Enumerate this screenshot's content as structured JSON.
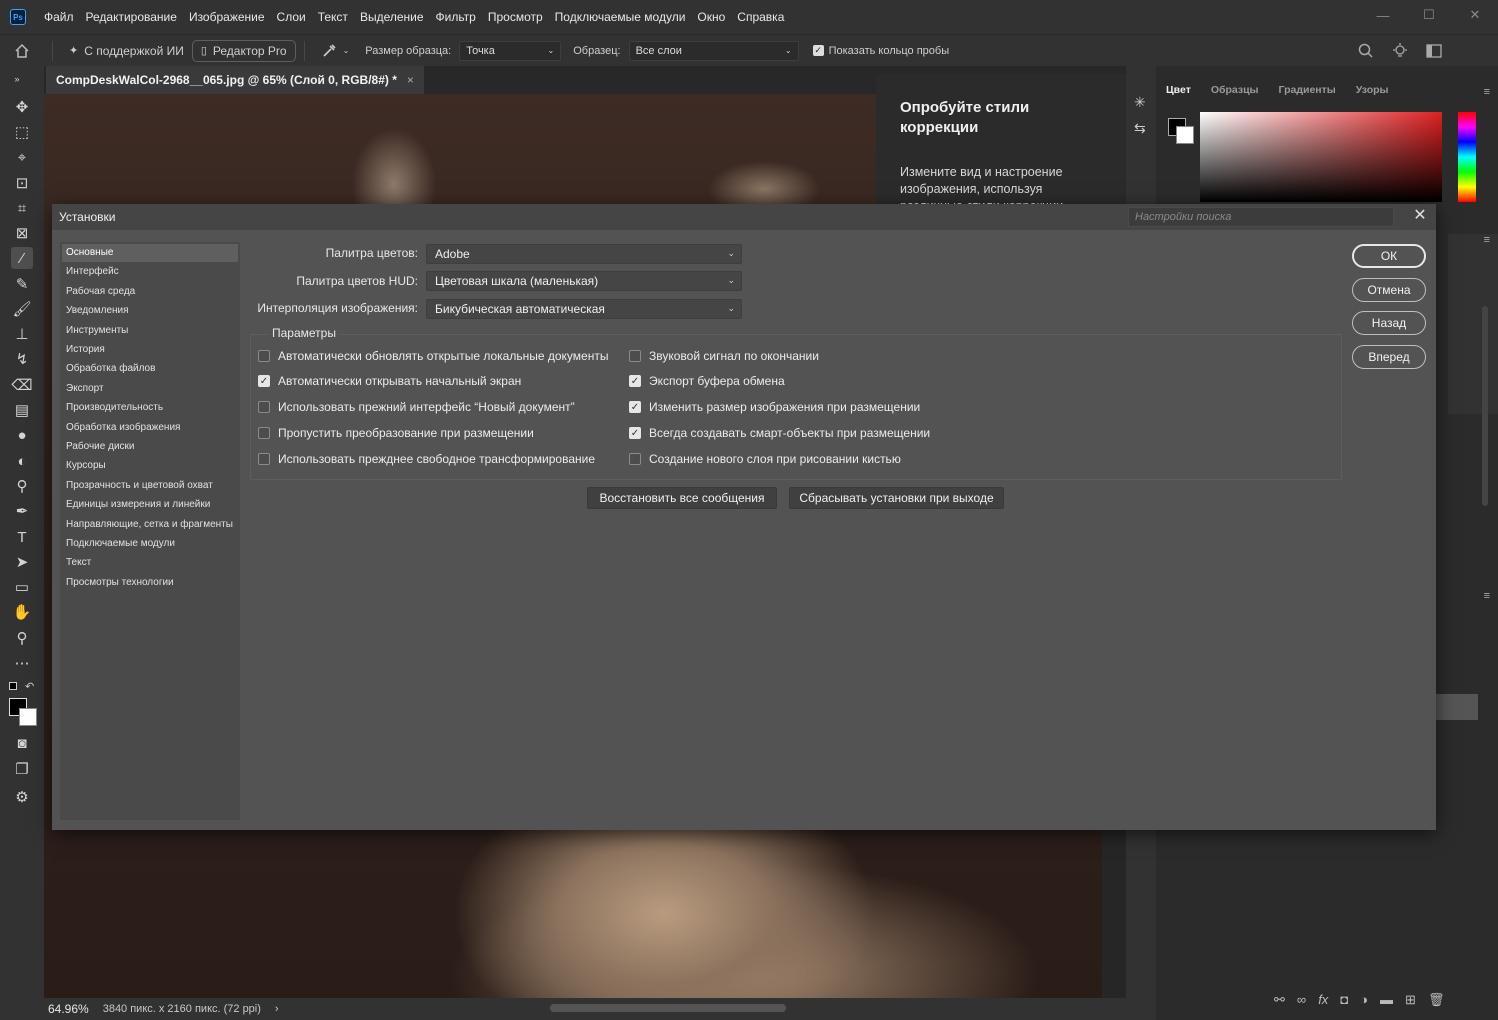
{
  "menubar": {
    "logo": "Ps",
    "items": [
      "Файл",
      "Редактирование",
      "Изображение",
      "Слои",
      "Текст",
      "Выделение",
      "Фильтр",
      "Просмотр",
      "Подключаемые модули",
      "Окно",
      "Справка"
    ],
    "window_controls": [
      "—",
      "☐",
      "✕"
    ]
  },
  "options": {
    "ai_label": "С поддержкой ИИ",
    "pro_label": "Редактор Pro",
    "sample_size_label": "Размер образца:",
    "sample_size_value": "Точка",
    "sample_label": "Образец:",
    "sample_value": "Все слои",
    "show_ring_label": "Показать кольцо пробы",
    "show_ring_checked": true
  },
  "document": {
    "tab_title": "CompDeskWalCol-2968__065.jpg @ 65% (Слой 0, RGB/8#) *",
    "zoom": "64.96%",
    "dimensions": "3840 пикс. x 2160 пикс. (72 ppi)"
  },
  "learn": {
    "title": "Опробуйте стили коррекции",
    "text": "Измените вид и настроение изображения, используя различные стили коррекции."
  },
  "color_panel": {
    "tabs": [
      "Цвет",
      "Образцы",
      "Градиенты",
      "Узоры"
    ],
    "active_tab": "Цвет",
    "fg_color": "#000000",
    "bg_color": "#ffffff"
  },
  "dialog": {
    "title": "Установки",
    "search_placeholder": "Настройки поиска",
    "nav": [
      "Основные",
      "Интерфейс",
      "Рабочая среда",
      "Уведомления",
      "Инструменты",
      "История",
      "Обработка файлов",
      "Экспорт",
      "Производительность",
      "Обработка изображения",
      "Рабочие диски",
      "Курсоры",
      "Прозрачность и цветовой охват",
      "Единицы измерения и линейки",
      "Направляющие, сетка и фрагменты",
      "Подключаемые модули",
      "Текст",
      "Просмотры технологии"
    ],
    "active_nav": "Основные",
    "fields": {
      "color_picker_label": "Палитра цветов:",
      "color_picker_value": "Adobe",
      "hud_picker_label": "Палитра цветов HUD:",
      "hud_picker_value": "Цветовая шкала (маленькая)",
      "interp_label": "Интерполяция изображения:",
      "interp_value": "Бикубическая автоматическая"
    },
    "params_title": "Параметры",
    "options_left": [
      {
        "label": "Автоматически обновлять открытые локальные документы",
        "checked": false
      },
      {
        "label": "Автоматически открывать начальный экран",
        "checked": true
      },
      {
        "label": "Использовать прежний интерфейс “Новый документ”",
        "checked": false
      },
      {
        "label": "Пропустить преобразование при размещении",
        "checked": false
      },
      {
        "label": "Использовать прежднее свободное трансформирование",
        "checked": false
      }
    ],
    "options_right": [
      {
        "label": "Звуковой сигнал по окончании",
        "checked": false
      },
      {
        "label": "Экспорт буфера обмена",
        "checked": true
      },
      {
        "label": "Изменить размер изображения при размещении",
        "checked": true
      },
      {
        "label": "Всегда создавать смарт-объекты при размещении",
        "checked": true
      },
      {
        "label": "Создание нового слоя при рисовании кистью",
        "checked": false
      }
    ],
    "restore_messages": "Восстановить все сообщения",
    "reset_on_exit": "Сбрасывать установки при выходе",
    "buttons": {
      "ok": "ОК",
      "cancel": "Отмена",
      "back": "Назад",
      "forward": "Вперед"
    }
  }
}
